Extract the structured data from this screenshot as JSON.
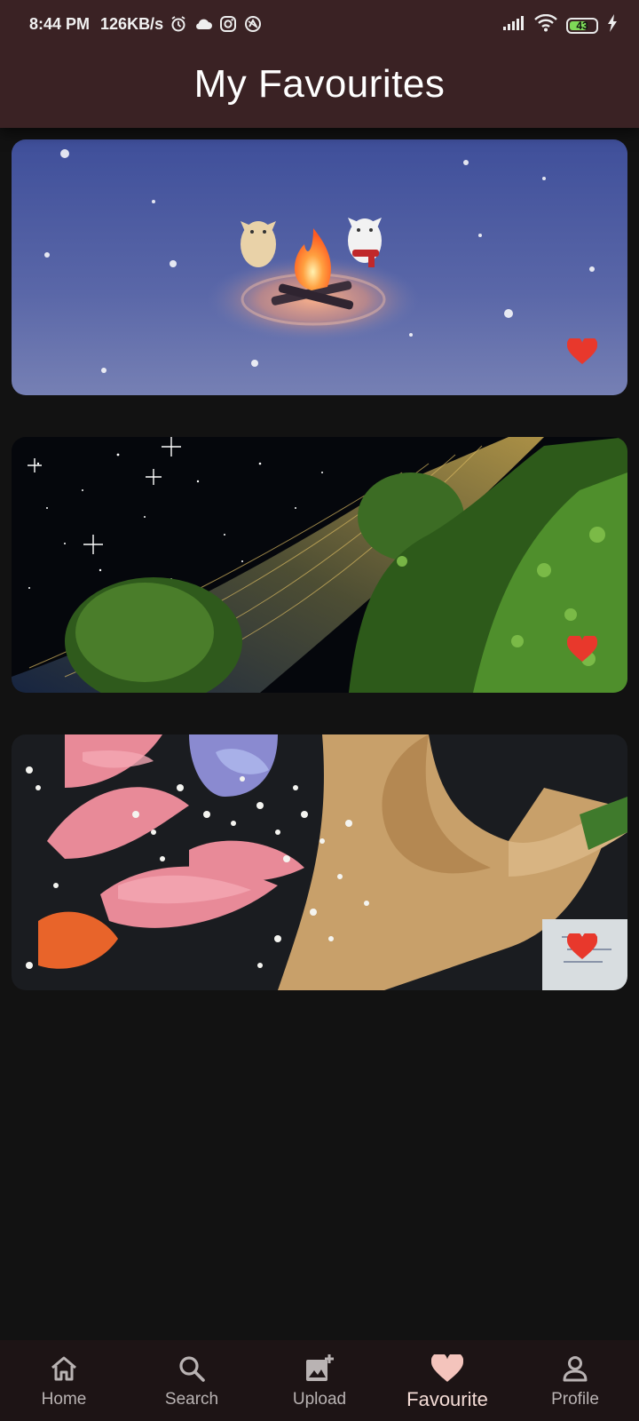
{
  "status_bar": {
    "time": "8:44 PM",
    "net_speed": "126KB/s",
    "battery_level": "43",
    "icons": [
      "alarm-icon",
      "cloud-icon",
      "instagram-icon",
      "vpn-icon",
      "signal-icon",
      "wifi-icon",
      "battery-icon",
      "charging-icon"
    ]
  },
  "app_bar": {
    "title": "My Favourites"
  },
  "favourites": [
    {
      "image": "cats-campfire-snow",
      "favourited": true,
      "icon": "heart-icon",
      "color": "#e8382c"
    },
    {
      "image": "starry-night-trees",
      "favourited": true,
      "icon": "heart-icon",
      "color": "#e8382c"
    },
    {
      "image": "flower-bouquet",
      "favourited": true,
      "icon": "heart-icon",
      "color": "#e8382c"
    }
  ],
  "bottom_nav": {
    "items": [
      {
        "label": "Home",
        "icon": "home-icon",
        "active": false
      },
      {
        "label": "Search",
        "icon": "search-icon",
        "active": false
      },
      {
        "label": "Upload",
        "icon": "add-photo-icon",
        "active": false
      },
      {
        "label": "Favourite",
        "icon": "heart-icon",
        "active": true
      },
      {
        "label": "Profile",
        "icon": "person-icon",
        "active": false
      }
    ],
    "active_color": "#f4c4bc",
    "inactive_color": "#b9b3b3"
  }
}
